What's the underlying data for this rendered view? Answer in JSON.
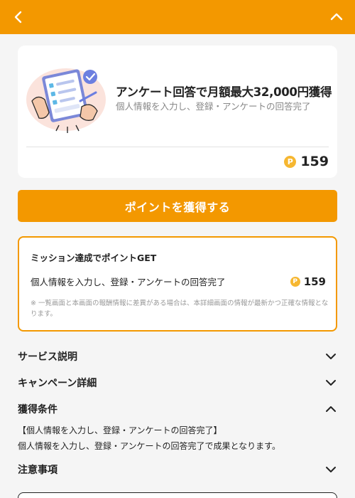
{
  "header": {
    "back_icon": "chevron-left-icon",
    "collapse_icon": "chevron-up-icon",
    "bg_color": "#f39800"
  },
  "offer": {
    "title": "アンケート回答で月額最大32,000円獲得",
    "subtitle": "個人情報を入力し、登録・アンケートの回答完了",
    "coin_symbol": "P",
    "points": "159",
    "illustration": "survey-form-illustration"
  },
  "cta": {
    "label": "ポイントを獲得する"
  },
  "mission": {
    "title": "ミッション達成でポイントGET",
    "condition": "個人情報を入力し、登録・アンケートの回答完了",
    "coin_symbol": "P",
    "points": "159",
    "note": "※ 一覧画面と本画面の報酬情報に差異がある場合は、本詳細画面の情報が最新かつ正確な情報となります。"
  },
  "sections": {
    "service": {
      "label": "サービス説明",
      "state": "collapsed"
    },
    "campaign": {
      "label": "キャンペーン詳細",
      "state": "collapsed"
    },
    "conditions": {
      "label": "獲得条件",
      "state": "expanded",
      "line1": "【個人情報を入力し、登録・アンケートの回答完了】",
      "line2": "個人情報を入力し、登録・アンケートの回答完了で成果となります。"
    },
    "notes": {
      "label": "注意事項",
      "state": "collapsed"
    }
  },
  "colors": {
    "accent": "#f39800",
    "coin": "#f6b731",
    "background": "#f5f5f5"
  }
}
